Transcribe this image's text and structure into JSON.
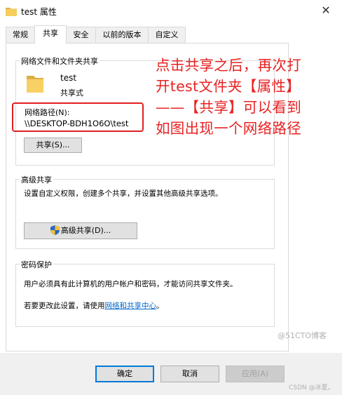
{
  "window": {
    "title": "test 属性",
    "close_glyph": "✕"
  },
  "tabs": [
    {
      "label": "常规"
    },
    {
      "label": "共享"
    },
    {
      "label": "安全"
    },
    {
      "label": "以前的版本"
    },
    {
      "label": "自定义"
    }
  ],
  "network_share": {
    "group_title": "网络文件和文件夹共享",
    "folder_name": "test",
    "folder_status": "共享式",
    "path_label": "网络路径(N):",
    "path_value": "\\\\DESKTOP-BDH1O6O\\test",
    "share_button": "共享(S)..."
  },
  "advanced_share": {
    "group_title": "高级共享",
    "description": "设置自定义权限，创建多个共享，并设置其他高级共享选项。",
    "button": "高级共享(D)..."
  },
  "password": {
    "group_title": "密码保护",
    "line1": "用户必须具有此计算机的用户帐户和密码，才能访问共享文件夹。",
    "line2_prefix": "若要更改此设置，请使用",
    "line2_link": "网络和共享中心",
    "line2_suffix": "。"
  },
  "buttons": {
    "ok": "确定",
    "cancel": "取消",
    "apply": "应用(A)"
  },
  "annotation": "点击共享之后，再次打\n开test文件夹【属性】\n——【共享】可以看到\n如图出现一个网络路径",
  "watermarks": {
    "w1": "@51CTO博客",
    "w2": "CSDN @冰夏。"
  },
  "colors": {
    "annotation": "#e82222",
    "red_box": "#e02020",
    "link": "#0066cc",
    "default_button_border": "#0078d7"
  }
}
